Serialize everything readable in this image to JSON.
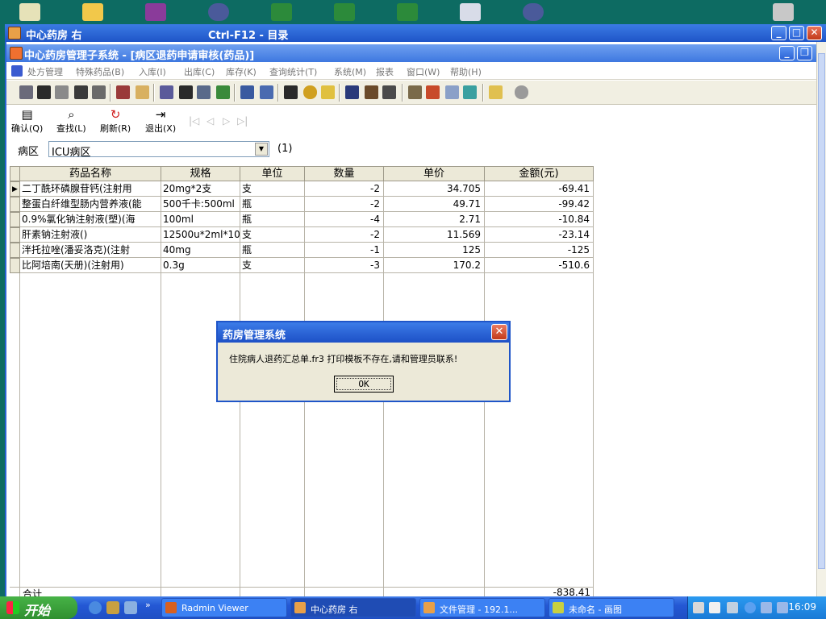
{
  "remote_window": {
    "title": "中心药房 右",
    "hotkey_hint": "Ctrl-F12 - 目录"
  },
  "app_window": {
    "title": "中心药房管理子系统 - [病区退药申请审核(药品)]"
  },
  "menu": {
    "items": [
      "处方管理",
      "特殊药品(B)",
      "入库(I)",
      "出库(C)",
      "库存(K)",
      "查询统计(T)",
      "系统(M)",
      "报表",
      "窗口(W)",
      "帮助(H)"
    ]
  },
  "actions": {
    "confirm": "确认(Q)",
    "find": "查找(L)",
    "refresh": "刷新(R)",
    "exit": "退出(X)"
  },
  "ward": {
    "label": "病区",
    "value": "ICU病区",
    "count": "(1)"
  },
  "table": {
    "columns": [
      "药品名称",
      "规格",
      "单位",
      "数量",
      "单价",
      "金额(元)"
    ],
    "rows": [
      {
        "name": "二丁酰环磷腺苷钙(注射用",
        "spec": "20mg*2支",
        "unit": "支",
        "qty": "-2",
        "price": "34.705",
        "amount": "-69.41"
      },
      {
        "name": "整蛋白纤维型肠内营养液(能",
        "spec": "500千卡:500ml",
        "unit": "瓶",
        "qty": "-2",
        "price": "49.71",
        "amount": "-99.42"
      },
      {
        "name": "0.9%氯化钠注射液(塑)(海",
        "spec": "100ml",
        "unit": "瓶",
        "qty": "-4",
        "price": "2.71",
        "amount": "-10.84"
      },
      {
        "name": "肝素钠注射液()",
        "spec": "12500u*2ml*10",
        "unit": "支",
        "qty": "-2",
        "price": "11.569",
        "amount": "-23.14"
      },
      {
        "name": "泮托拉唑(潘妥洛克)(注射",
        "spec": "40mg",
        "unit": "瓶",
        "qty": "-1",
        "price": "125",
        "amount": "-125"
      },
      {
        "name": "比阿培南(天册)(注射用)",
        "spec": "0.3g",
        "unit": "支",
        "qty": "-3",
        "price": "170.2",
        "amount": "-510.6"
      }
    ],
    "total_label": "合计",
    "total_amount": "-838.41"
  },
  "dialog": {
    "title": "药房管理系统",
    "message": "住院病人退药汇总单.fr3 打印模板不存在,请和管理员联系!",
    "ok_label": "OK"
  },
  "taskbar": {
    "start_label": "开始",
    "tasks": [
      "Radmin Viewer",
      "中心药房 右",
      "文件管理 - 192.1...",
      "未命名 - 画图"
    ],
    "clock": "16:09"
  },
  "colors": {
    "desktop": "#0d6b62",
    "title_blue": "#1f55c8",
    "taskbar_blue": "#2458d4",
    "start_green": "#3a9a3a"
  }
}
